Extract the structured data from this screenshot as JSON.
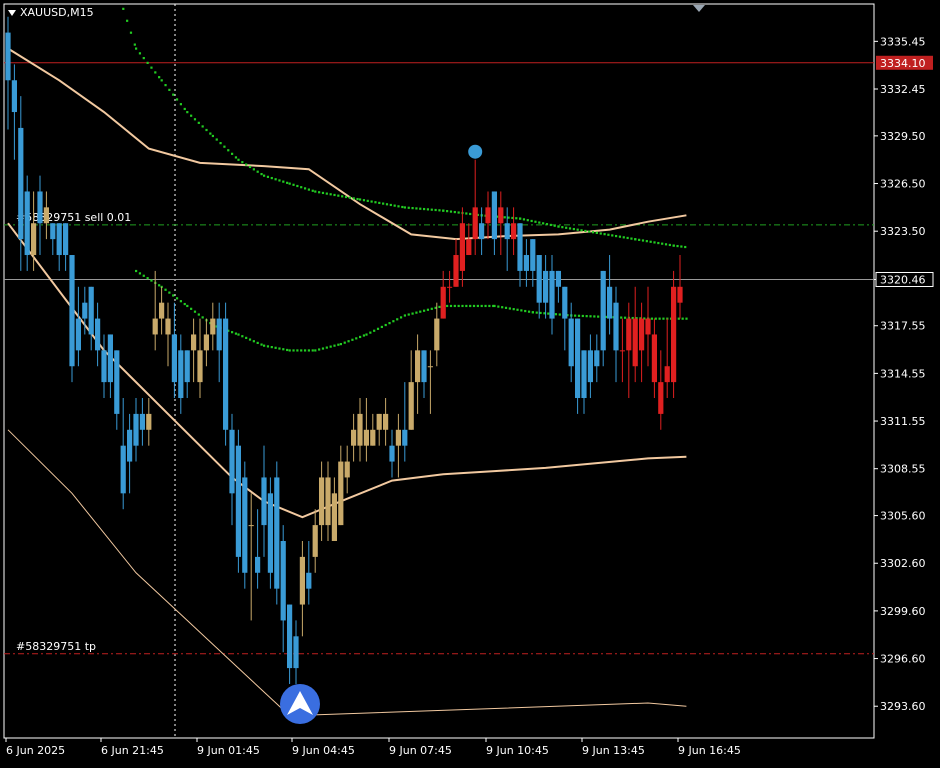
{
  "header": {
    "symbol_label": "XAUUSD,M15"
  },
  "colors": {
    "bg": "#000000",
    "frame": "#ffffff",
    "bull_body": "#c9aa6a",
    "bear_body": "#3a9bd6",
    "bull_red": "#e02020",
    "ma": "#f2c9a0",
    "psar": "#22cc22",
    "order_line": "#20a020",
    "tp_line": "#c02020",
    "price_line": "#999999",
    "ask_line": "#c02020"
  },
  "price_tags": {
    "ask": "3334.10",
    "bid": "3320.46"
  },
  "order_labels": {
    "sell": "#58329751 sell 0.01",
    "tp": "#58329751 tp"
  },
  "chart_data": {
    "type": "candlestick",
    "title": "",
    "symbol": "XAUUSD",
    "timeframe": "M15",
    "ylim": [
      3291.6,
      3337.8
    ],
    "y_ticks": [
      "3335.45",
      "3332.45",
      "3329.50",
      "3326.50",
      "3323.50",
      "3320.46",
      "3317.55",
      "3314.55",
      "3311.55",
      "3308.55",
      "3305.60",
      "3302.60",
      "3299.60",
      "3296.60",
      "3293.60"
    ],
    "x_tick_labels": [
      "6 Jun 2025",
      "6 Jun 21:45",
      "9 Jun 01:45",
      "9 Jun 04:45",
      "9 Jun 07:45",
      "9 Jun 10:45",
      "9 Jun 13:45",
      "9 Jun 16:45"
    ],
    "levels": {
      "ask": 3334.1,
      "bid": 3320.46,
      "sell_entry": 3323.9,
      "take_profit": 3296.9
    },
    "candles": [
      [
        3336,
        3337,
        3329.9,
        3333
      ],
      [
        3333,
        3334,
        3328,
        3331
      ],
      [
        3330,
        3332,
        3321,
        3323
      ],
      [
        3326,
        3327,
        3321,
        3322
      ],
      [
        3322,
        3326,
        3321,
        3324
      ],
      [
        3326,
        3327,
        3322,
        3324
      ],
      [
        3324,
        3326,
        3323,
        3325
      ],
      [
        3324,
        3324,
        3322,
        3323
      ],
      [
        3324,
        3324,
        3321,
        3322
      ],
      [
        3324,
        3324,
        3321,
        3322
      ],
      [
        3322,
        3322,
        3314,
        3315
      ],
      [
        3318,
        3320,
        3315,
        3316
      ],
      [
        3319,
        3320,
        3317,
        3318
      ],
      [
        3320,
        3320,
        3316,
        3317
      ],
      [
        3318,
        3319,
        3315,
        3316
      ],
      [
        3316,
        3317,
        3313,
        3314
      ],
      [
        3317,
        3317,
        3313,
        3314
      ],
      [
        3316,
        3316,
        3311,
        3312
      ],
      [
        3310,
        3313,
        3306,
        3307
      ],
      [
        3311,
        3312,
        3307,
        3309
      ],
      [
        3312,
        3313,
        3309,
        3310
      ],
      [
        3312,
        3313,
        3310,
        3311
      ],
      [
        3311,
        3313,
        3310,
        3312
      ],
      [
        3317,
        3321,
        3316,
        3318
      ],
      [
        3318,
        3320,
        3317,
        3319
      ],
      [
        3317,
        3319,
        3315,
        3318
      ],
      [
        3317,
        3319,
        3313,
        3314
      ],
      [
        3316,
        3317,
        3312,
        3313
      ],
      [
        3316,
        3316,
        3313,
        3314
      ],
      [
        3316,
        3318,
        3314,
        3317
      ],
      [
        3314,
        3318,
        3313,
        3316
      ],
      [
        3316,
        3318,
        3315,
        3317
      ],
      [
        3317,
        3319,
        3316,
        3318
      ],
      [
        3318,
        3319,
        3314,
        3316
      ],
      [
        3318,
        3319,
        3310,
        3311
      ],
      [
        3311,
        3312,
        3305,
        3307
      ],
      [
        3310,
        3311,
        3302,
        3303
      ],
      [
        3308,
        3309,
        3301,
        3302
      ],
      [
        3305,
        3307,
        3299,
        3305
      ],
      [
        3303,
        3306,
        3301,
        3302
      ],
      [
        3308,
        3310,
        3303,
        3305
      ],
      [
        3307,
        3308,
        3301,
        3302
      ],
      [
        3308,
        3309,
        3300,
        3301
      ],
      [
        3304,
        3305,
        3297,
        3299
      ],
      [
        3300,
        3300,
        3295,
        3296
      ],
      [
        3298,
        3299,
        3295,
        3296
      ],
      [
        3300,
        3304,
        3298,
        3303
      ],
      [
        3302,
        3304,
        3300,
        3301
      ],
      [
        3303,
        3306,
        3302,
        3305
      ],
      [
        3305,
        3309,
        3304,
        3308
      ],
      [
        3305,
        3309,
        3304,
        3308
      ],
      [
        3304,
        3308,
        3304,
        3307
      ],
      [
        3305,
        3310,
        3305,
        3309
      ],
      [
        3308,
        3310,
        3307,
        3309
      ],
      [
        3310,
        3312,
        3309,
        3311
      ],
      [
        3310,
        3313,
        3309,
        3312
      ],
      [
        3310,
        3313,
        3309,
        3311
      ],
      [
        3310,
        3312,
        3310,
        3311
      ],
      [
        3311,
        3312,
        3310,
        3312
      ],
      [
        3311,
        3313,
        3310,
        3312
      ],
      [
        3310,
        3311,
        3308,
        3309
      ],
      [
        3310,
        3312,
        3308,
        3311
      ],
      [
        3311,
        3314,
        3309,
        3310
      ],
      [
        3311,
        3316,
        3311,
        3314
      ],
      [
        3314,
        3317,
        3312,
        3316
      ],
      [
        3316,
        3316,
        3313,
        3314
      ],
      [
        3315,
        3316,
        3312,
        3315
      ],
      [
        3316,
        3319,
        3315,
        3318
      ],
      [
        3318,
        3321,
        3318,
        3320
      ],
      [
        3320,
        3321,
        3319,
        3320
      ],
      [
        3320,
        3323,
        3320,
        3322
      ],
      [
        3321,
        3325,
        3320,
        3324
      ],
      [
        3322,
        3324,
        3322,
        3323
      ],
      [
        3323,
        3328,
        3322,
        3325
      ],
      [
        3324,
        3325,
        3322,
        3323
      ],
      [
        3324,
        3326,
        3323,
        3325
      ],
      [
        3326,
        3326,
        3322,
        3323
      ],
      [
        3324,
        3326,
        3322,
        3325
      ],
      [
        3324,
        3325,
        3321,
        3323
      ],
      [
        3323,
        3325,
        3322,
        3324
      ],
      [
        3324,
        3324,
        3320,
        3321
      ],
      [
        3322,
        3323,
        3320,
        3321
      ],
      [
        3323,
        3323,
        3320,
        3321
      ],
      [
        3322,
        3322,
        3318,
        3319
      ],
      [
        3321,
        3322,
        3318,
        3319
      ],
      [
        3321,
        3322,
        3317,
        3318
      ],
      [
        3321,
        3321,
        3319,
        3320
      ],
      [
        3320,
        3320,
        3316,
        3318
      ],
      [
        3318,
        3319,
        3314,
        3315
      ],
      [
        3318,
        3318,
        3312,
        3313
      ],
      [
        3316,
        3316,
        3312,
        3313
      ],
      [
        3316,
        3317,
        3313,
        3314
      ],
      [
        3316,
        3317,
        3314,
        3315
      ],
      [
        3321,
        3321,
        3315,
        3316
      ],
      [
        3320,
        3322,
        3317,
        3318
      ],
      [
        3319,
        3320,
        3314,
        3316
      ],
      [
        3316,
        3318,
        3314,
        3316
      ],
      [
        3318,
        3319,
        3313,
        3316
      ],
      [
        3318,
        3320,
        3314,
        3315
      ],
      [
        3318,
        3319,
        3314,
        3316
      ],
      [
        3318,
        3320,
        3315,
        3317
      ],
      [
        3317,
        3318,
        3313,
        3314
      ],
      [
        3314,
        3316,
        3311,
        3312
      ],
      [
        3315,
        3318,
        3313,
        3314
      ],
      [
        3320,
        3321,
        3313,
        3314
      ],
      [
        3320,
        3322,
        3318,
        3319
      ]
    ],
    "ma_fast": [
      [
        0,
        3324
      ],
      [
        15,
        3316
      ],
      [
        25,
        3312
      ],
      [
        35,
        3308
      ],
      [
        40,
        3306.5
      ],
      [
        46,
        3305.5
      ],
      [
        52,
        3306.5
      ],
      [
        60,
        3307.8
      ],
      [
        68,
        3308.2
      ],
      [
        76,
        3308.4
      ],
      [
        84,
        3308.6
      ],
      [
        92,
        3308.9
      ],
      [
        100,
        3309.2
      ],
      [
        106,
        3309.3
      ]
    ],
    "ma_slow": [
      [
        0,
        3335
      ],
      [
        8,
        3333
      ],
      [
        15,
        3331
      ],
      [
        22,
        3328.7
      ],
      [
        30,
        3327.8
      ],
      [
        40,
        3327.6
      ],
      [
        47,
        3327.4
      ],
      [
        55,
        3325.2
      ],
      [
        63,
        3323.3
      ],
      [
        70,
        3323.0
      ],
      [
        78,
        3323.2
      ],
      [
        86,
        3323.3
      ],
      [
        94,
        3323.6
      ],
      [
        100,
        3324.1
      ],
      [
        106,
        3324.5
      ]
    ],
    "ma_lower": [
      [
        0,
        3311
      ],
      [
        10,
        3307
      ],
      [
        20,
        3302
      ],
      [
        28,
        3299
      ],
      [
        36,
        3296
      ],
      [
        44,
        3293
      ],
      [
        100,
        3293.8
      ],
      [
        106,
        3293.6
      ]
    ],
    "psar_upper": [
      [
        18,
        3337.5
      ],
      [
        20,
        3335
      ],
      [
        24,
        3333
      ],
      [
        28,
        3331
      ],
      [
        32,
        3329.5
      ],
      [
        36,
        3328
      ],
      [
        40,
        3327
      ],
      [
        44,
        3326.5
      ],
      [
        48,
        3326
      ],
      [
        55,
        3325.5
      ],
      [
        62,
        3325
      ],
      [
        68,
        3324.8
      ],
      [
        74,
        3324.5
      ],
      [
        80,
        3324.3
      ],
      [
        86,
        3323.8
      ],
      [
        92,
        3323.4
      ],
      [
        98,
        3323
      ],
      [
        104,
        3322.6
      ],
      [
        106,
        3322.5
      ]
    ],
    "psar_lower": [
      [
        20,
        3321
      ],
      [
        24,
        3320
      ],
      [
        28,
        3318.8
      ],
      [
        32,
        3317.6
      ],
      [
        36,
        3317.0
      ],
      [
        40,
        3316.3
      ],
      [
        44,
        3316.0
      ],
      [
        48,
        3316.0
      ],
      [
        52,
        3316.4
      ],
      [
        56,
        3317.0
      ],
      [
        62,
        3318.2
      ],
      [
        68,
        3318.8
      ],
      [
        76,
        3318.8
      ],
      [
        82,
        3318.4
      ],
      [
        88,
        3318.2
      ],
      [
        94,
        3318.1
      ],
      [
        100,
        3318.0
      ],
      [
        106,
        3318.0
      ]
    ],
    "arrow_top_candle": 73,
    "arrow_bottom_candle": 45
  }
}
